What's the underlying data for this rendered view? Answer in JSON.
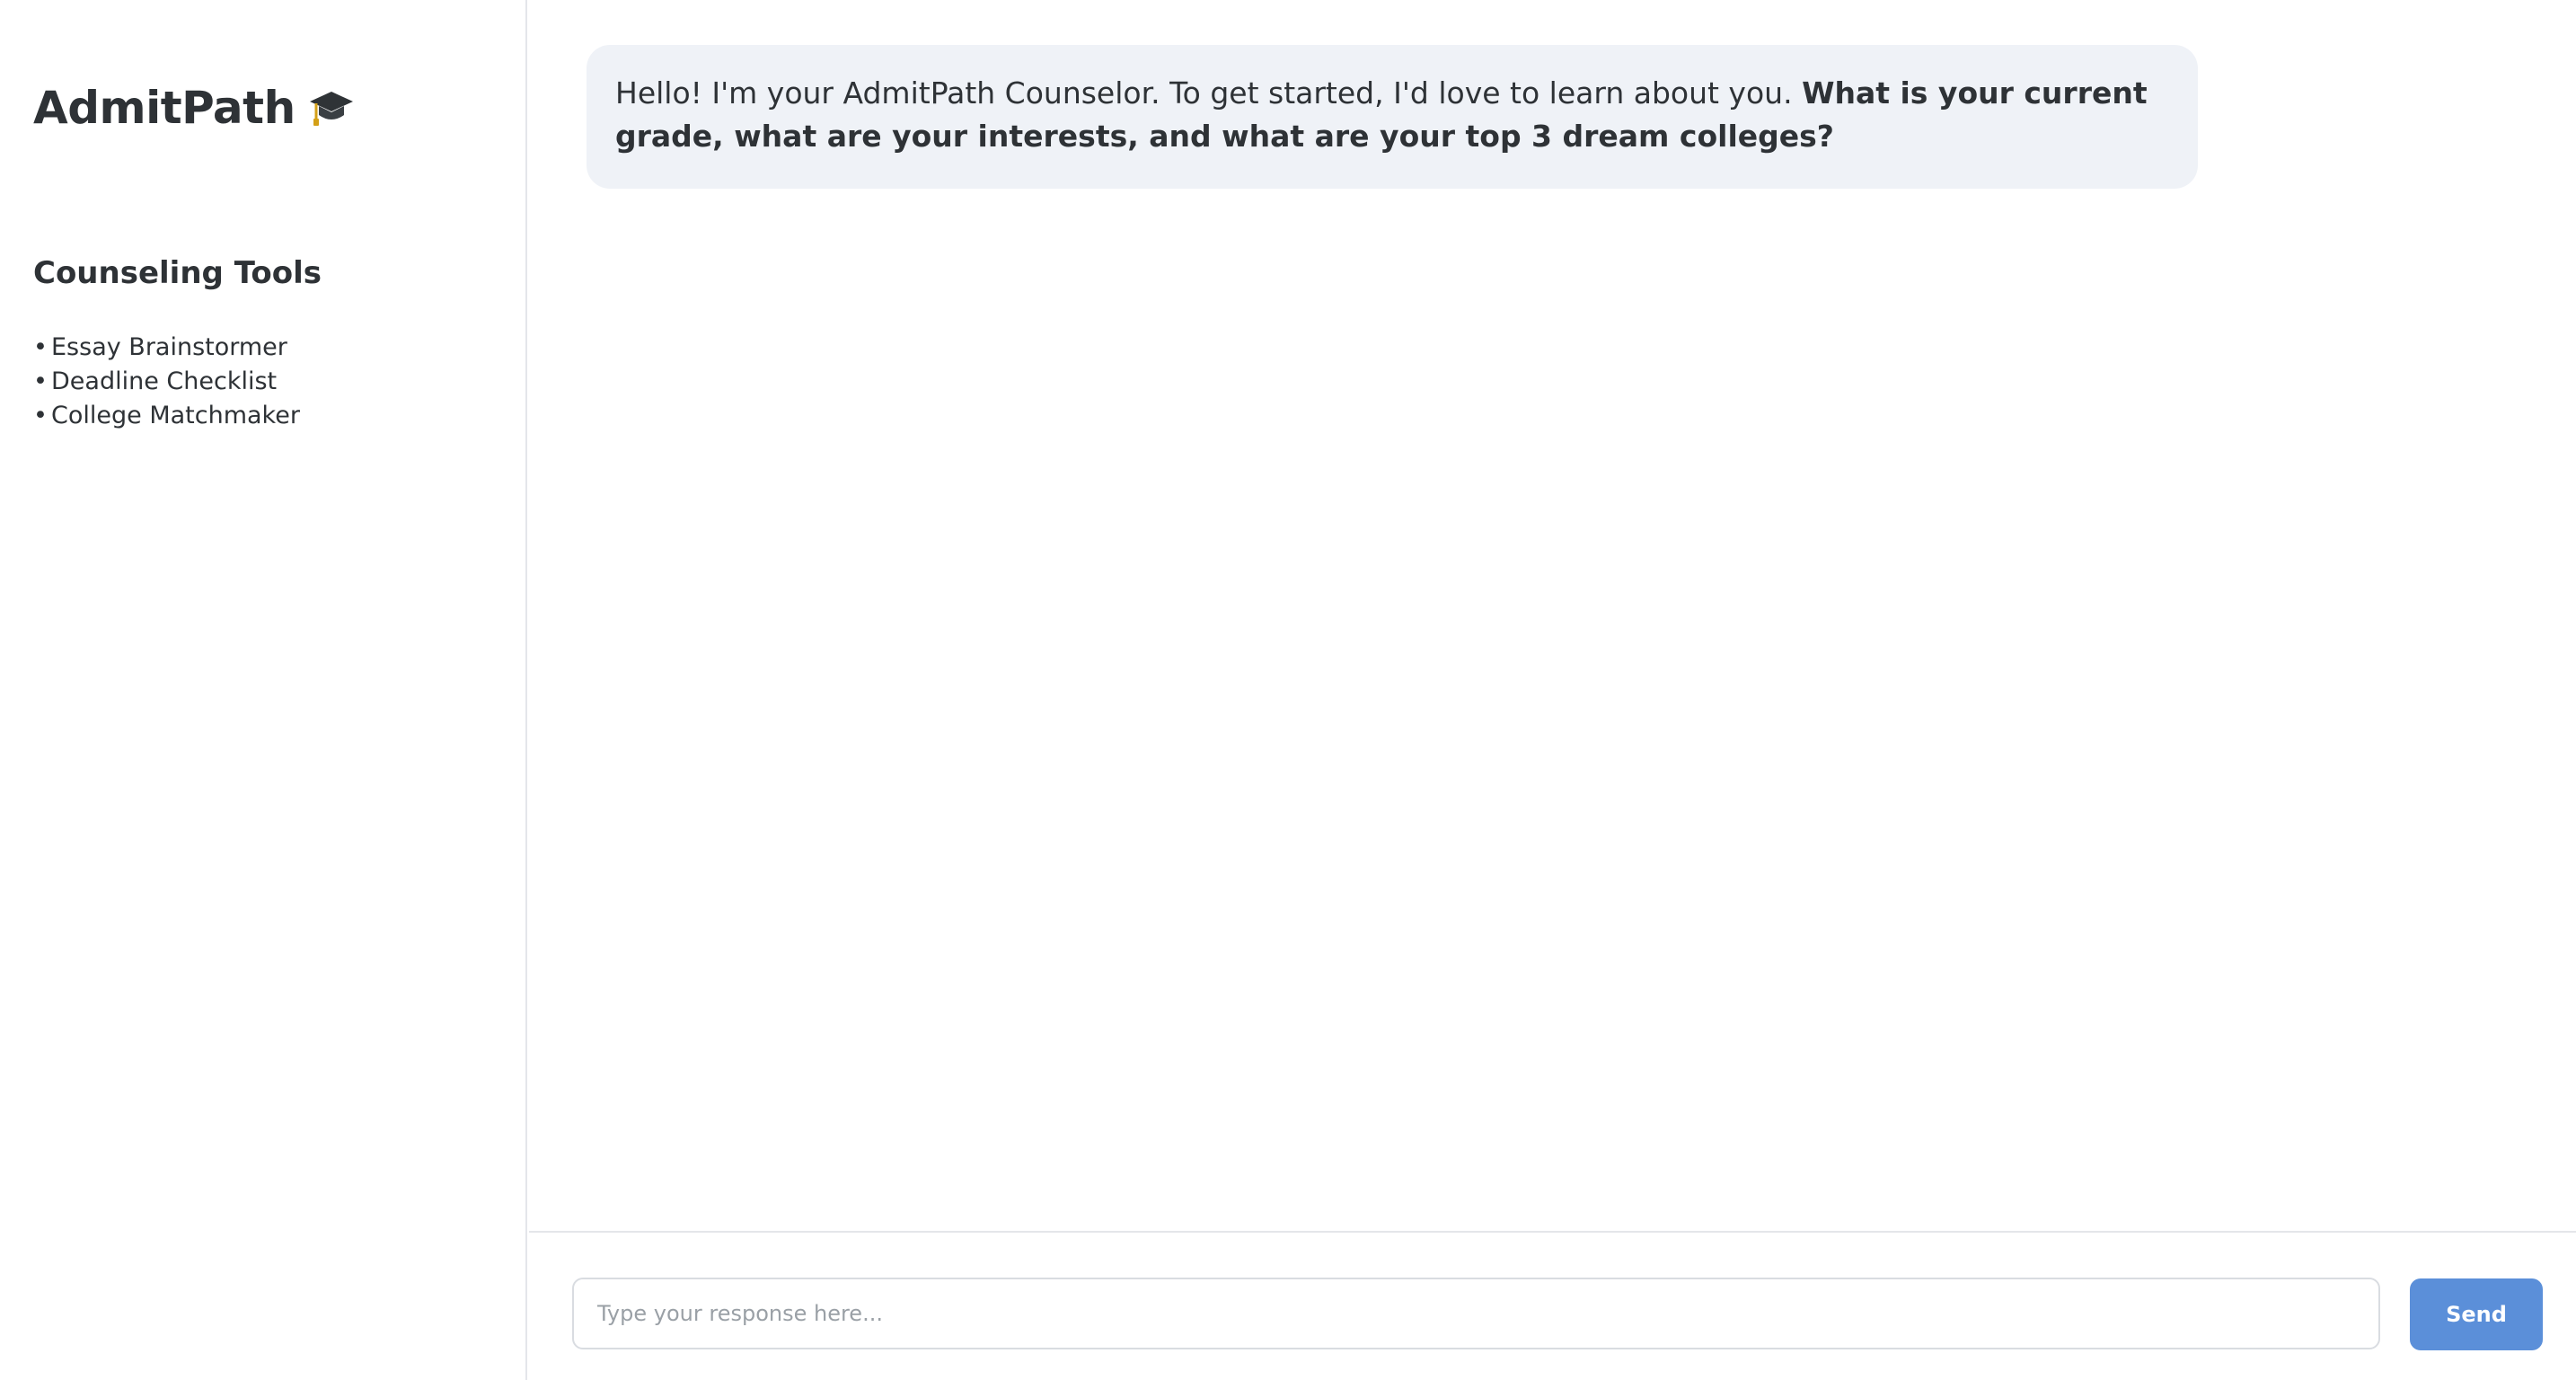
{
  "sidebar": {
    "brand": {
      "title": "AdmitPath",
      "icon": "graduation-cap-icon"
    },
    "tools_heading": "Counseling Tools",
    "tools": [
      {
        "bullet": "•",
        "label": "Essay Brainstormer"
      },
      {
        "bullet": "•",
        "label": "Deadline Checklist"
      },
      {
        "bullet": "•",
        "label": "College Matchmaker"
      }
    ]
  },
  "chat": {
    "messages": [
      {
        "sender": "counselor",
        "text_plain": "Hello! I'm your AdmitPath Counselor. To get started, I'd love to learn about you. ",
        "text_bold": "What is your current grade, what are your interests, and what are your top 3 dream colleges?"
      }
    ]
  },
  "composer": {
    "placeholder": "Type your response here...",
    "value": "",
    "send_label": "Send"
  },
  "colors": {
    "accent": "#5b8fd9",
    "message_bg": "#eff2f7",
    "text": "#2e3236",
    "border": "#e4e6ea"
  }
}
